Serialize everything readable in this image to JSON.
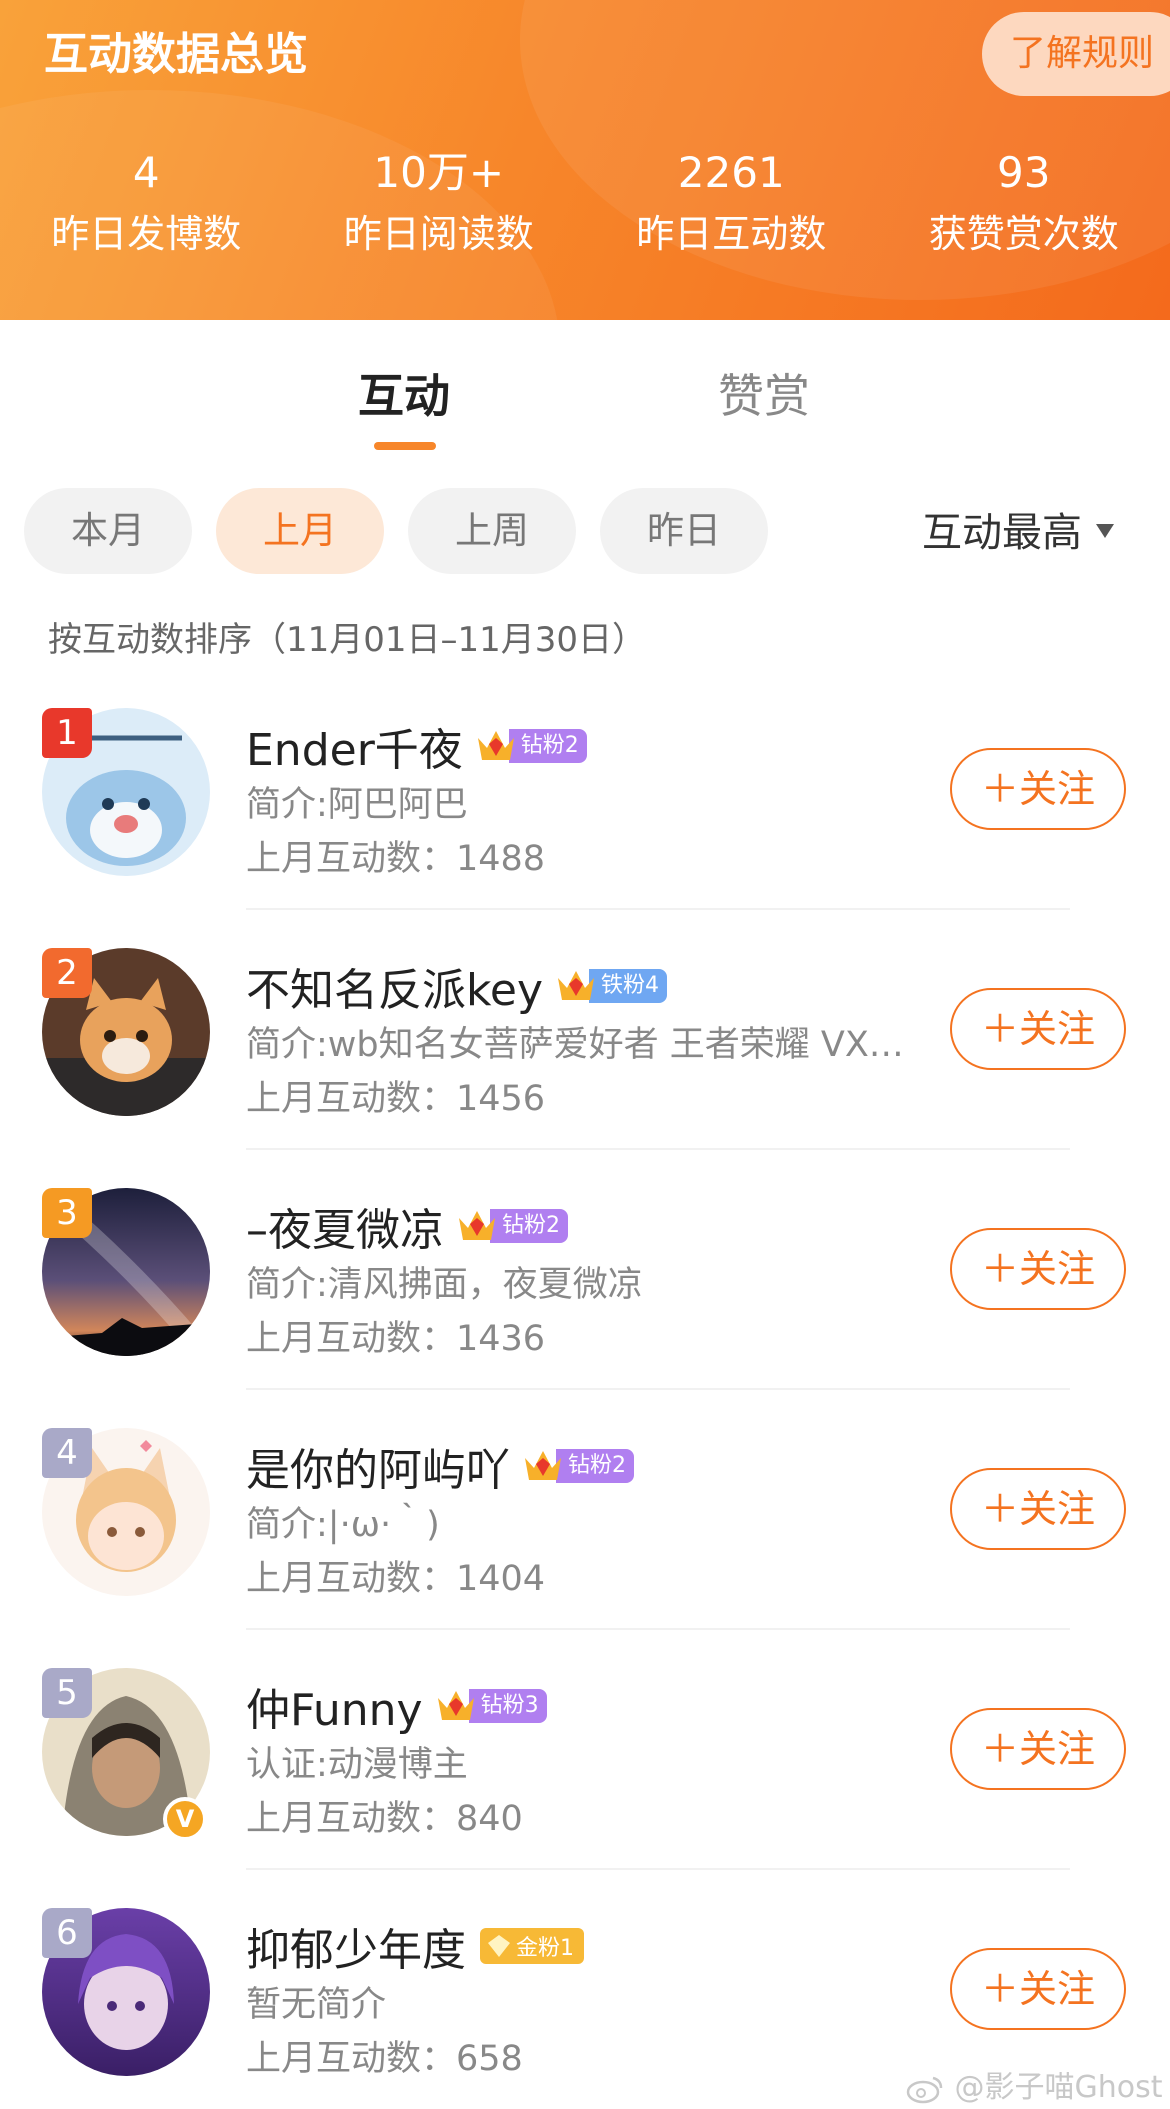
{
  "header": {
    "title": "互动数据总览",
    "rules_button": "了解规则",
    "stats": [
      {
        "value": "4",
        "label": "昨日发博数"
      },
      {
        "value": "10万+",
        "label": "昨日阅读数"
      },
      {
        "value": "2261",
        "label": "昨日互动数"
      },
      {
        "value": "93",
        "label": "获赞赏次数"
      }
    ]
  },
  "tabs": {
    "interact": "互动",
    "reward": "赞赏"
  },
  "filters": {
    "chips": [
      "本月",
      "上月",
      "上周",
      "昨日"
    ],
    "selected": "上月",
    "sort_label": "互动最高"
  },
  "sort_description": "按互动数排序（11月01日–11月30日）",
  "follow_label": "＋关注",
  "list": [
    {
      "rank": "1",
      "name": "Ender千夜",
      "badge": "钻粉2",
      "crown_level": "4",
      "bio": "简介:阿巴阿巴",
      "count": "上月互动数：1488"
    },
    {
      "rank": "2",
      "name": "不知名反派key",
      "badge": "铁粉4",
      "crown_level": "6",
      "bio": "简介:wb知名女菩萨爱好者 王者荣耀 VX…",
      "count": "上月互动数：1456"
    },
    {
      "rank": "3",
      "name": "–夜夏微凉",
      "badge": "钻粉2",
      "crown_level": "7",
      "bio": "简介:清风拂面，夜夏微凉",
      "count": "上月互动数：1436"
    },
    {
      "rank": "4",
      "name": "是你的阿屿吖",
      "badge": "钻粉2",
      "crown_level": "6",
      "bio": "简介:|·ω·｀)",
      "count": "上月互动数：1404"
    },
    {
      "rank": "5",
      "name": "仲Funny",
      "badge": "钻粉3",
      "crown_level": "7",
      "bio": "认证:动漫博主",
      "count": "上月互动数：840"
    },
    {
      "rank": "6",
      "name": "抑郁少年度",
      "badge": "金粉1",
      "crown_level": "",
      "bio": "暂无简介",
      "count": "上月互动数：658"
    }
  ],
  "watermark": "@影子喵Ghost",
  "colors": {
    "accent": "#f47320",
    "rank_1": "#e8382b",
    "rank_2": "#f26a2e",
    "rank_3": "#f59a23",
    "rank_other": "#a9a9c8",
    "badge_diamond": "#b07ff0",
    "badge_iron": "#6fa7f2",
    "badge_gold": "#f7b936"
  }
}
